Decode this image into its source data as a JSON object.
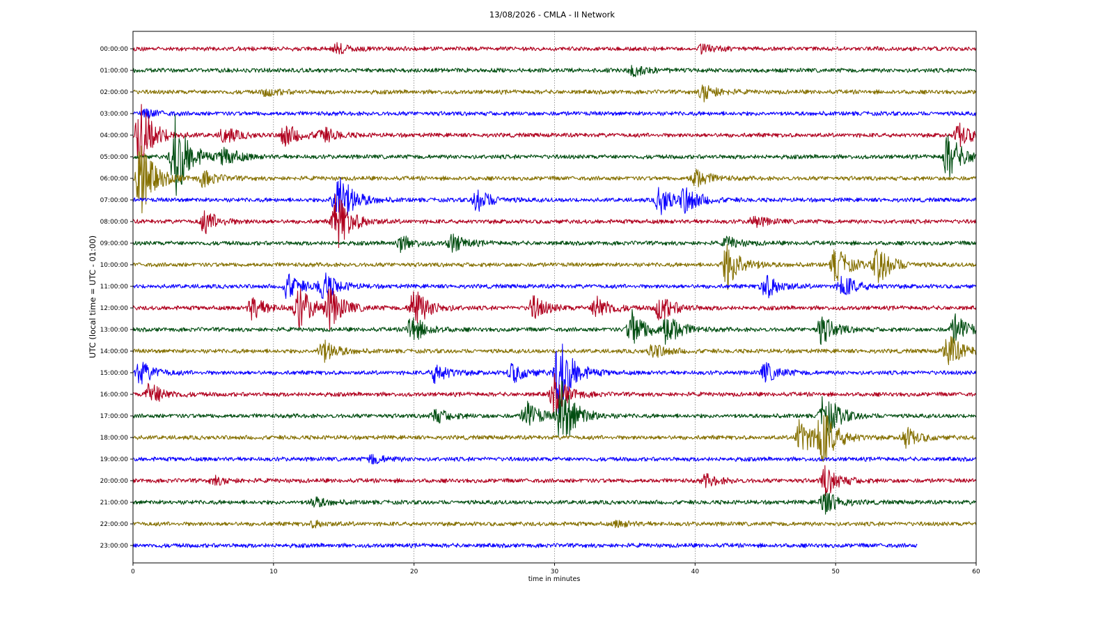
{
  "chart_data": {
    "type": "line",
    "title": "13/08/2026 - CMLA - II Network",
    "xlabel": "time in minutes",
    "ylabel": "UTC (local time = UTC - 01:00)",
    "xlim": [
      0,
      60
    ],
    "x_ticks": [
      0,
      10,
      20,
      30,
      40,
      50,
      60
    ],
    "x_tick_labels": [
      "0",
      "10",
      "20",
      "30",
      "40",
      "50",
      "60"
    ],
    "grid": "vertical dotted at major x ticks",
    "colors": [
      "#b0001e",
      "#004d10",
      "#857000",
      "#0a00ff"
    ],
    "last_trace_end_minute": 55.8,
    "series": [
      {
        "label": "00:00:00",
        "events": [
          [
            14.5,
            0.5
          ],
          [
            40.5,
            0.4
          ]
        ]
      },
      {
        "label": "01:00:00",
        "events": [
          [
            35.5,
            0.6
          ]
        ]
      },
      {
        "label": "02:00:00",
        "events": [
          [
            9.5,
            0.4
          ],
          [
            40.6,
            0.9
          ]
        ]
      },
      {
        "label": "03:00:00",
        "events": [
          [
            1.0,
            0.4
          ]
        ]
      },
      {
        "label": "04:00:00",
        "events": [
          [
            0.5,
            3.5
          ],
          [
            6.5,
            0.9
          ],
          [
            10.8,
            1.2
          ],
          [
            13.5,
            0.8
          ],
          [
            58.8,
            1.2
          ]
        ]
      },
      {
        "label": "05:00:00",
        "events": [
          [
            3.0,
            4.5
          ],
          [
            6.5,
            1.0
          ],
          [
            58.0,
            2.5
          ]
        ]
      },
      {
        "label": "06:00:00",
        "events": [
          [
            0.5,
            4.0
          ],
          [
            5.0,
            0.8
          ],
          [
            40.0,
            1.0
          ]
        ]
      },
      {
        "label": "07:00:00",
        "events": [
          [
            14.5,
            3.5
          ],
          [
            24.5,
            1.2
          ],
          [
            37.5,
            1.5
          ],
          [
            39.3,
            1.3
          ]
        ]
      },
      {
        "label": "08:00:00",
        "events": [
          [
            5.1,
            1.2
          ],
          [
            14.5,
            3.0
          ],
          [
            44.2,
            0.6
          ]
        ]
      },
      {
        "label": "09:00:00",
        "events": [
          [
            19.0,
            0.8
          ],
          [
            22.7,
            0.9
          ],
          [
            42.3,
            0.6
          ]
        ]
      },
      {
        "label": "10:00:00",
        "events": [
          [
            42.3,
            2.5
          ],
          [
            50.0,
            1.8
          ],
          [
            53.0,
            2.0
          ]
        ]
      },
      {
        "label": "11:00:00",
        "events": [
          [
            11.0,
            1.3
          ],
          [
            13.5,
            1.5
          ],
          [
            45.0,
            1.3
          ],
          [
            50.5,
            1.2
          ]
        ]
      },
      {
        "label": "12:00:00",
        "events": [
          [
            8.5,
            1.2
          ],
          [
            11.8,
            2.2
          ],
          [
            14.0,
            2.0
          ],
          [
            20.0,
            2.2
          ],
          [
            28.5,
            1.2
          ],
          [
            33.0,
            1.3
          ],
          [
            37.5,
            1.4
          ]
        ]
      },
      {
        "label": "13:00:00",
        "events": [
          [
            19.8,
            1.5
          ],
          [
            35.5,
            2.0
          ],
          [
            38.0,
            1.6
          ],
          [
            49.0,
            1.5
          ],
          [
            58.5,
            1.5
          ]
        ]
      },
      {
        "label": "14:00:00",
        "events": [
          [
            13.5,
            1.2
          ],
          [
            37.0,
            0.8
          ],
          [
            58.0,
            1.8
          ]
        ]
      },
      {
        "label": "15:00:00",
        "events": [
          [
            0.5,
            1.2
          ],
          [
            21.5,
            1.0
          ],
          [
            27.0,
            1.0
          ],
          [
            30.3,
            4.0
          ],
          [
            45.0,
            1.0
          ]
        ]
      },
      {
        "label": "16:00:00",
        "events": [
          [
            1.2,
            1.2
          ],
          [
            30.0,
            2.0
          ]
        ]
      },
      {
        "label": "17:00:00",
        "events": [
          [
            21.5,
            0.8
          ],
          [
            28.0,
            1.5
          ],
          [
            30.5,
            3.5
          ],
          [
            49.2,
            2.5
          ]
        ]
      },
      {
        "label": "18:00:00",
        "events": [
          [
            47.5,
            2.0
          ],
          [
            49.0,
            3.0
          ],
          [
            55.0,
            1.0
          ]
        ]
      },
      {
        "label": "19:00:00",
        "events": [
          [
            17.0,
            0.5
          ]
        ]
      },
      {
        "label": "20:00:00",
        "events": [
          [
            5.8,
            0.4
          ],
          [
            40.8,
            0.6
          ],
          [
            49.3,
            1.5
          ]
        ]
      },
      {
        "label": "21:00:00",
        "events": [
          [
            12.9,
            0.5
          ],
          [
            49.2,
            1.3
          ]
        ]
      },
      {
        "label": "22:00:00",
        "events": [
          [
            12.9,
            0.3
          ],
          [
            34.5,
            0.3
          ]
        ]
      },
      {
        "label": "23:00:00",
        "events": []
      }
    ]
  }
}
